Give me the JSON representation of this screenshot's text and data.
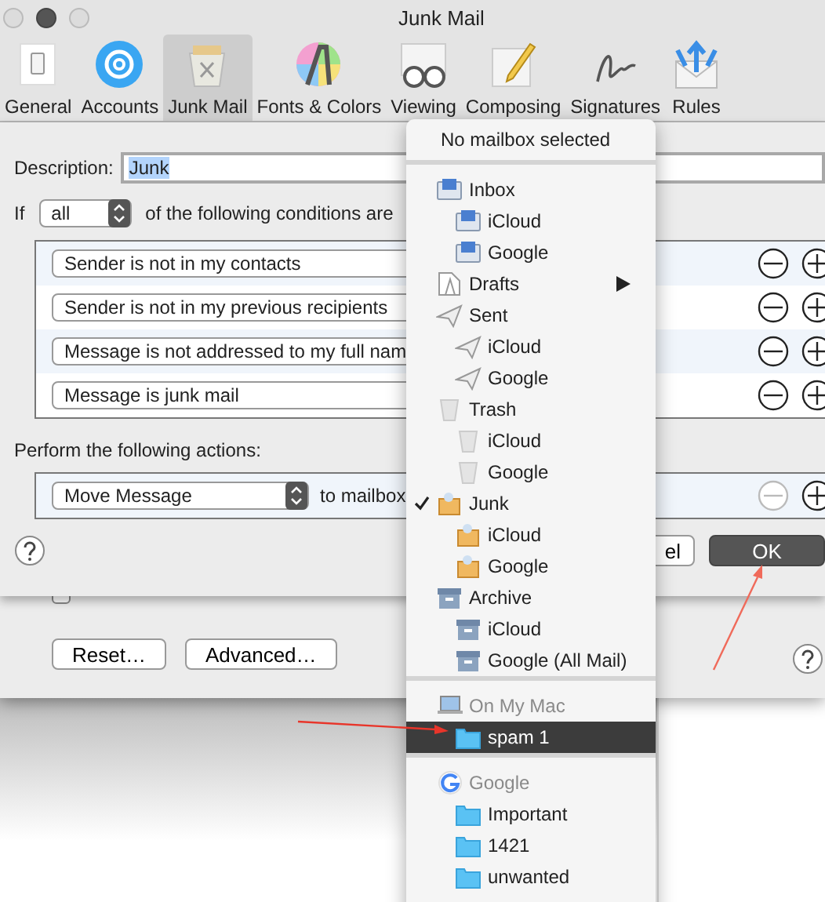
{
  "window": {
    "title": "Junk Mail"
  },
  "toolbar": [
    {
      "label": "General",
      "kind": "general",
      "selected": false
    },
    {
      "label": "Accounts",
      "kind": "accounts",
      "selected": false
    },
    {
      "label": "Junk Mail",
      "kind": "junk",
      "selected": true
    },
    {
      "label": "Fonts & Colors",
      "kind": "fonts",
      "selected": false
    },
    {
      "label": "Viewing",
      "kind": "viewing",
      "selected": false
    },
    {
      "label": "Composing",
      "kind": "composing",
      "selected": false
    },
    {
      "label": "Signatures",
      "kind": "signatures",
      "selected": false
    },
    {
      "label": "Rules",
      "kind": "rules",
      "selected": false
    }
  ],
  "junk_pane": {
    "filter_option": {
      "checked": false
    },
    "buttons": [
      "Reset…",
      "Advanced…"
    ]
  },
  "rule_sheet": {
    "description_label": "Description:",
    "description": "Junk",
    "if_label": "If",
    "match": "all",
    "conditions_text": "of the following conditions are",
    "conditions": [
      {
        "text": "Sender is not in my contacts"
      },
      {
        "text": "Sender is not in my previous recipients"
      },
      {
        "text": "Message is not addressed to my full nam"
      },
      {
        "text": "Message is junk mail"
      }
    ],
    "actions_label": "Perform the following actions:",
    "actions": [
      {
        "action": "Move Message",
        "target_label": "to mailbox",
        "remove_disabled": true
      }
    ],
    "cancel_button": "el",
    "ok_button": "OK"
  },
  "mailbox_menu": {
    "placeholder_item": "No mailbox selected",
    "sections": [
      {
        "items": [
          {
            "label": "Inbox",
            "kind": "inbox",
            "checked": false,
            "selected": false,
            "submenu": false,
            "children": [
              {
                "label": "iCloud",
                "checked": false,
                "selected": false
              },
              {
                "label": "Google",
                "checked": false,
                "selected": false
              }
            ]
          },
          {
            "label": "Drafts",
            "kind": "drafts",
            "checked": false,
            "selected": false,
            "submenu": true
          },
          {
            "label": "Sent",
            "kind": "sent",
            "checked": false,
            "selected": false,
            "submenu": false,
            "children": [
              {
                "label": "iCloud",
                "checked": false,
                "selected": false
              },
              {
                "label": "Google",
                "checked": false,
                "selected": false
              }
            ]
          },
          {
            "label": "Trash",
            "kind": "trash",
            "checked": false,
            "selected": false,
            "submenu": false,
            "children": [
              {
                "label": "iCloud",
                "checked": false,
                "selected": false
              },
              {
                "label": "Google",
                "checked": false,
                "selected": false
              }
            ]
          },
          {
            "label": "Junk",
            "kind": "junk",
            "checked": true,
            "selected": false,
            "submenu": false,
            "children": [
              {
                "label": "iCloud",
                "checked": false,
                "selected": false
              },
              {
                "label": "Google",
                "checked": false,
                "selected": false
              }
            ]
          },
          {
            "label": "Archive",
            "kind": "archive",
            "checked": false,
            "selected": false,
            "submenu": false,
            "children": [
              {
                "label": "iCloud",
                "checked": false,
                "selected": false
              },
              {
                "label": "Google (All Mail)",
                "checked": false,
                "selected": false
              }
            ]
          }
        ]
      },
      {
        "heading": "On My Mac",
        "kind": "computer",
        "items": [
          {
            "label": "spam 1",
            "kind": "folder",
            "checked": false,
            "selected": true
          }
        ]
      },
      {
        "heading": "Google",
        "kind": "google",
        "items": [
          {
            "label": "Important",
            "kind": "folder",
            "checked": false,
            "selected": false
          },
          {
            "label": "1421",
            "kind": "folder",
            "checked": false,
            "selected": false
          },
          {
            "label": "unwanted",
            "kind": "folder",
            "checked": false,
            "selected": false
          }
        ]
      }
    ]
  }
}
